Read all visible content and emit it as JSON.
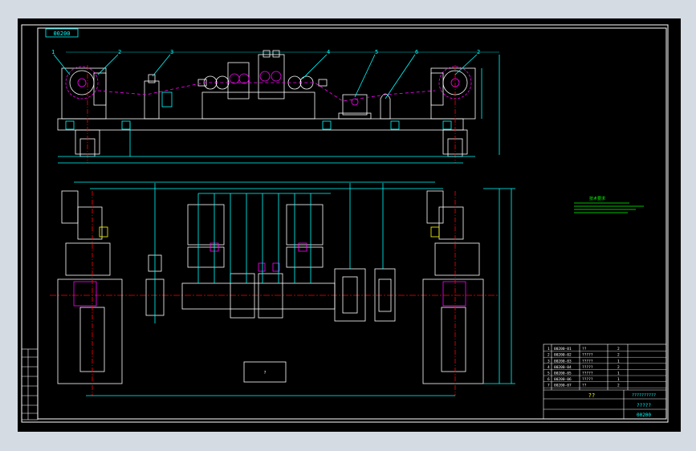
{
  "drawing": {
    "code_top": "00200",
    "code_bottom": "00200",
    "balloons": [
      "1",
      "2",
      "3",
      "4",
      "5",
      "6",
      "2"
    ],
    "tech_title": "技术要求",
    "title_main": "??",
    "title_sub": "?????",
    "title_small": "??????????",
    "center_box_label": "?",
    "colors": {
      "background": "#000000",
      "outline": "#ffffff",
      "dimension": "#00ffff",
      "accent": "#ff00ff",
      "note": "#00ff00",
      "hidden": "#ffff00",
      "centerline": "#ff0000"
    }
  },
  "parts_list": {
    "rows": [
      {
        "no": "1",
        "code": "00200-01",
        "name": "??",
        "qty": "2"
      },
      {
        "no": "2",
        "code": "00200-02",
        "name": "?????",
        "qty": "2"
      },
      {
        "no": "3",
        "code": "00200-03",
        "name": "?????",
        "qty": "1"
      },
      {
        "no": "4",
        "code": "00200-04",
        "name": "?????",
        "qty": "2"
      },
      {
        "no": "5",
        "code": "00200-05",
        "name": "?????",
        "qty": "1"
      },
      {
        "no": "6",
        "code": "00200-06",
        "name": "?????",
        "qty": "1"
      },
      {
        "no": "7",
        "code": "00200-07",
        "name": "??",
        "qty": "2"
      }
    ]
  }
}
